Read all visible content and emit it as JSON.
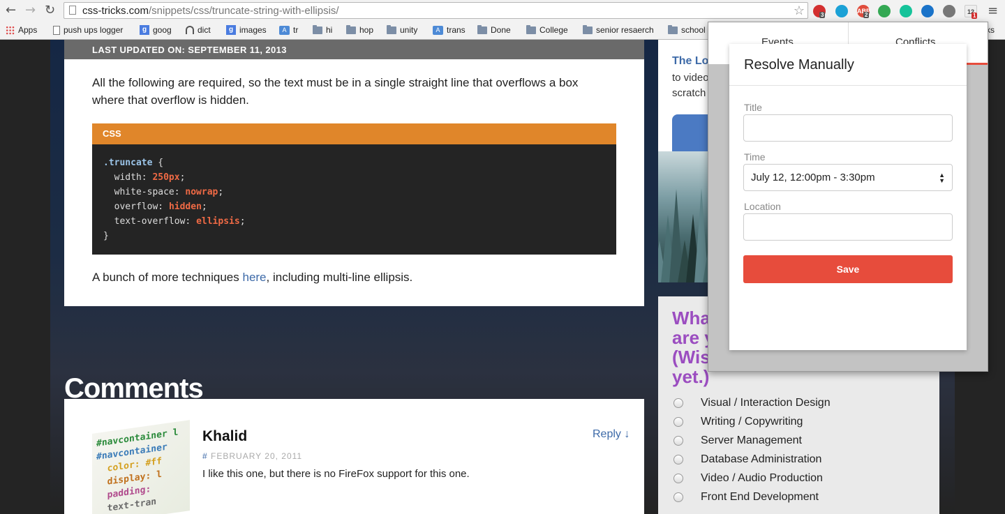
{
  "browser": {
    "url_host": "css-tricks.com",
    "url_path": "/snippets/css/truncate-string-with-ellipsis/",
    "extensions": [
      {
        "icon": "stop-icon",
        "color": "#d32f2f",
        "badge": "3"
      },
      {
        "icon": "eye-icon",
        "color": "#1ba1d6",
        "badge": ""
      },
      {
        "icon": "adblock-icon",
        "color": "#e04c3c",
        "label": "ABP",
        "badge": "2"
      },
      {
        "icon": "drive-icon",
        "color": "#34a853",
        "badge": ""
      },
      {
        "icon": "grammarly-icon",
        "color": "#15c39a",
        "badge": ""
      },
      {
        "icon": "y-icon",
        "color": "#1a73c9",
        "badge": ""
      },
      {
        "icon": "puzzle-icon",
        "color": "#777777",
        "badge": ""
      },
      {
        "icon": "calendar-icon",
        "color": "#eeeeee",
        "label": "12",
        "badge": "1"
      }
    ],
    "bookmarks": [
      {
        "label": "Apps",
        "icon": "apps-icon"
      },
      {
        "label": "push ups logger",
        "icon": "page-icon"
      },
      {
        "label": "goog",
        "icon": "google-icon"
      },
      {
        "label": "dict",
        "icon": "wifi-icon"
      },
      {
        "label": "images",
        "icon": "google-icon"
      },
      {
        "label": "tr",
        "icon": "translate-icon"
      },
      {
        "label": "hi",
        "icon": "folder-icon"
      },
      {
        "label": "hop",
        "icon": "folder-icon"
      },
      {
        "label": "unity",
        "icon": "folder-icon"
      },
      {
        "label": "trans",
        "icon": "translate-icon"
      },
      {
        "label": "Done",
        "icon": "folder-icon"
      },
      {
        "label": "College",
        "icon": "folder-icon"
      },
      {
        "label": "senior resaerch",
        "icon": "folder-icon"
      },
      {
        "label": "school",
        "icon": "folder-icon"
      },
      {
        "label": "ks",
        "icon": ""
      }
    ]
  },
  "article": {
    "updated": "LAST UPDATED ON: SEPTEMBER 11, 2013",
    "intro_line1": "All the following are required, so the text must be in a single straight line that overflows a box",
    "intro_line2": "where that overflow is hidden.",
    "code_lang": "CSS",
    "code": {
      "selector": ".truncate",
      "open": " {",
      "close": "}",
      "decls": [
        {
          "prop": "width",
          "value": "250px"
        },
        {
          "prop": "white-space",
          "value": "nowrap"
        },
        {
          "prop": "overflow",
          "value": "hidden"
        },
        {
          "prop": "text-overflow",
          "value": "ellipsis"
        }
      ]
    },
    "more_pre": "A bunch of more techniques ",
    "more_link": "here",
    "more_post": ", including multi-line ellipsis."
  },
  "comments": {
    "title": "Comments",
    "author": "Khalid",
    "hash": "#",
    "date": "FEBRUARY 20, 2011",
    "text": "I like this one, but there is no FireFox support for this one.",
    "reply": "Reply ↓",
    "thumb_lines": [
      "#navcontainer l",
      "#navcontainer",
      "  color: #ff",
      "  display: l",
      "  padding:",
      "  text-tran"
    ]
  },
  "sidebar": {
    "link": "The Lo",
    "text": "to video\nscratch",
    "poll_question": "Wha\nare y\n(Wis\nyet.)",
    "poll_options": [
      "Visual / Interaction Design",
      "Writing / Copywriting",
      "Server Management",
      "Database Administration",
      "Video / Audio Production",
      "Front End Development"
    ]
  },
  "popup": {
    "tab_events": "Events",
    "tab_conflicts": "Conflicts",
    "dialog_title": "Resolve Manually",
    "title_label": "Title",
    "title_value": "",
    "time_label": "Time",
    "time_value": "July 12, 12:00pm - 3:30pm",
    "location_label": "Location",
    "location_value": "",
    "save_label": "Save"
  },
  "colors": {
    "accent_red": "#e74c3c",
    "code_header": "#e0862a",
    "link_blue": "#3d6aa8",
    "poll_purple": "#9b4dc0"
  }
}
